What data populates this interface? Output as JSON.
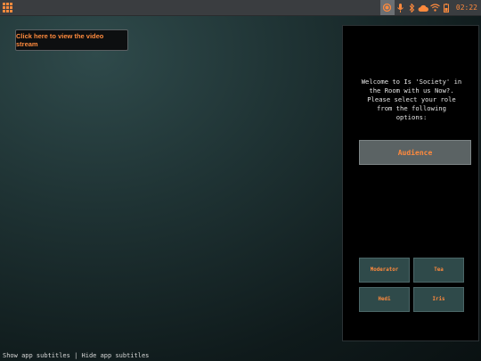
{
  "topbar": {
    "clock": "02:22",
    "icons": [
      "apps-grid-icon",
      "record-icon",
      "microphone-icon",
      "bluetooth-icon",
      "cloud-icon",
      "wifi-icon",
      "battery-icon"
    ],
    "accent": "#ff8a3d"
  },
  "stream": {
    "button_label": "Click here to view the video stream"
  },
  "panel": {
    "welcome_lines": [
      "Welcome to Is 'Society' in",
      "the Room with us Now?.",
      "Please select your role",
      "from the following",
      "options:"
    ],
    "primary_role": "Audience",
    "roles": [
      "Moderator",
      "Tea",
      "Hedi",
      "Iris"
    ]
  },
  "footer": {
    "show_label": "Show app subtitles",
    "separator": " | ",
    "hide_label": "Hide app subtitles"
  }
}
